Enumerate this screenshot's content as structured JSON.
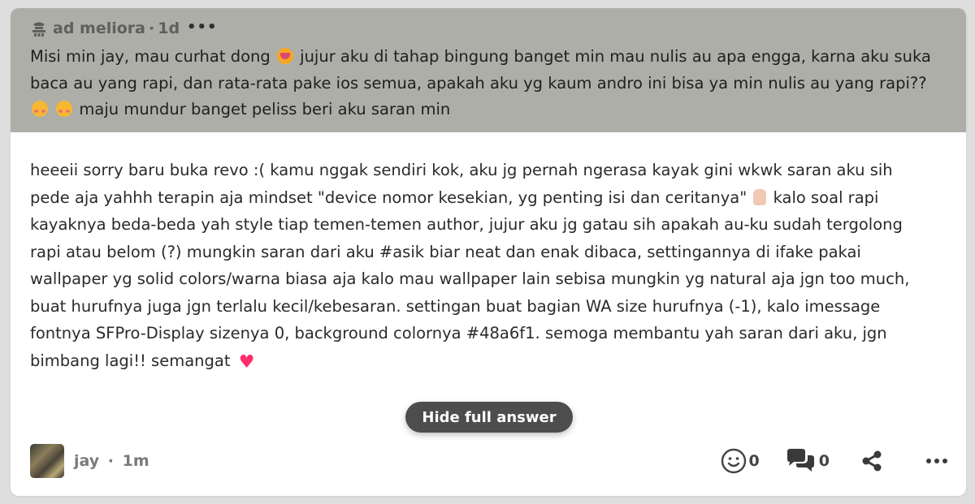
{
  "question": {
    "author": "ad meliora",
    "time": "1d",
    "more_label": "•••",
    "text_part1": "Misi min jay, mau curhat dong",
    "text_part2": "jujur aku di tahap bingung banget min mau nulis au apa engga, karna aku suka baca au yang rapi, dan rata-rata pake ios semua, apakah aku yg kaum andro ini bisa ya min nulis au yang rapi??",
    "text_part3": "maju mundur banget peliss beri aku saran min"
  },
  "answer": {
    "text_part1": "heeeii sorry baru buka revo :( kamu nggak sendiri kok, aku jg pernah ngerasa kayak gini wkwk saran aku sih pede aja yahhh terapin aja mindset \"device nomor kesekian, yg penting isi dan ceritanya\"",
    "text_part2": "kalo soal rapi kayaknya beda-beda yah style tiap temen-temen author, jujur aku jg gatau sih apakah au-ku sudah tergolong rapi atau belom (?) mungkin saran dari aku #asik biar neat dan enak dibaca, settingannya di ifake pakai wallpaper yg solid colors/warna biasa aja kalo mau wallpaper lain sebisa mungkin yg natural aja jgn too much, buat hurufnya juga jgn terlalu kecil/kebesaran. settingan buat bagian WA size hurufnya (-1), kalo imessage fontnya SFPro-Display sizenya 0, background colornya #48a6f1. semoga membantu yah saran dari aku, jgn bimbang lagi!! semangat",
    "heart": "♥"
  },
  "hide_button_label": "Hide full answer",
  "footer": {
    "author": "jay",
    "time": "1m",
    "reactions_count": "0",
    "comments_count": "0",
    "more_label": "•••"
  },
  "colors": {
    "question_bg": "#adaea8",
    "button_bg": "#4d4d4d",
    "heart": "#ff2d6b"
  }
}
